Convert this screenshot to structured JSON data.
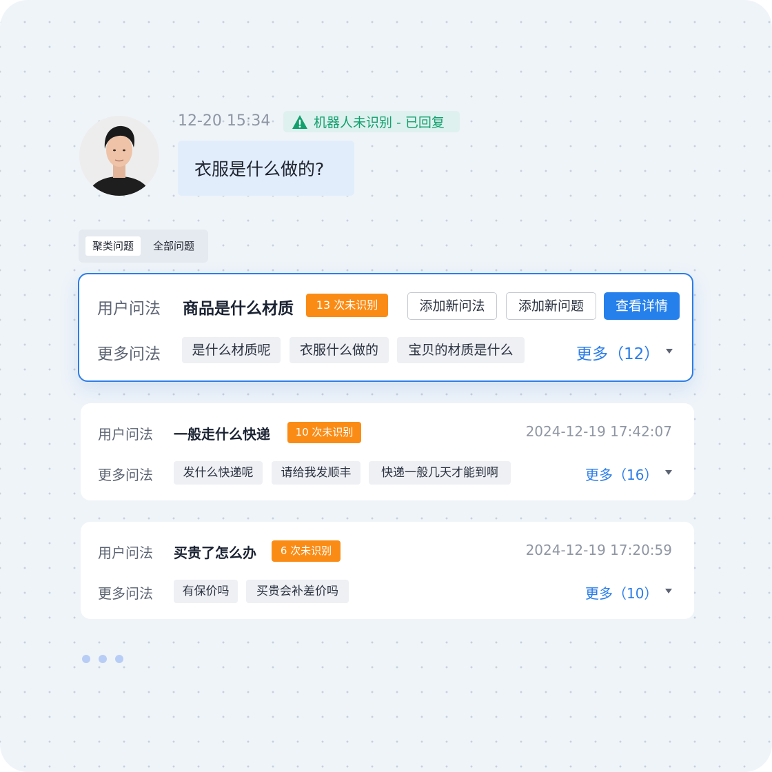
{
  "message": {
    "time": "12-20 15:34",
    "status": "机器人未识别 - 已回复",
    "text": "衣服是什么做的?"
  },
  "tabs": [
    "聚类问题",
    "全部问题"
  ],
  "cards": [
    {
      "label": "用户问法",
      "question": "商品是什么材质",
      "badge": "13 次未识别",
      "more_label": "更多问法",
      "variants": [
        "是什么材质呢",
        "衣服什么做的",
        "宝贝的材质是什么"
      ],
      "more_link": "更多（12）",
      "actions": {
        "add_phrasing": "添加新问法",
        "add_question": "添加新问题",
        "view_details": "查看详情"
      }
    },
    {
      "label": "用户问法",
      "question": "一般走什么快递",
      "badge": "10 次未识别",
      "datetime": "2024-12-19 17:42:07",
      "more_label": "更多问法",
      "variants": [
        "发什么快递呢",
        "请给我发顺丰",
        "快递一般几天才能到啊"
      ],
      "more_link": "更多（16）"
    },
    {
      "label": "用户问法",
      "question": "买贵了怎么办",
      "badge": "6 次未识别",
      "datetime": "2024-12-19 17:20:59",
      "more_label": "更多问法",
      "variants": [
        "有保价吗",
        "买贵会补差价吗"
      ],
      "more_link": "更多（10）"
    }
  ],
  "colors": {
    "accent": "#2680eb",
    "warning_badge": "#fa8c16",
    "success_text": "#12a06e",
    "bubble": "#e1edfb"
  },
  "icons": {
    "status": "warning-triangle-icon",
    "caret": "caret-down-icon",
    "loading": "loading-dots-icon"
  }
}
